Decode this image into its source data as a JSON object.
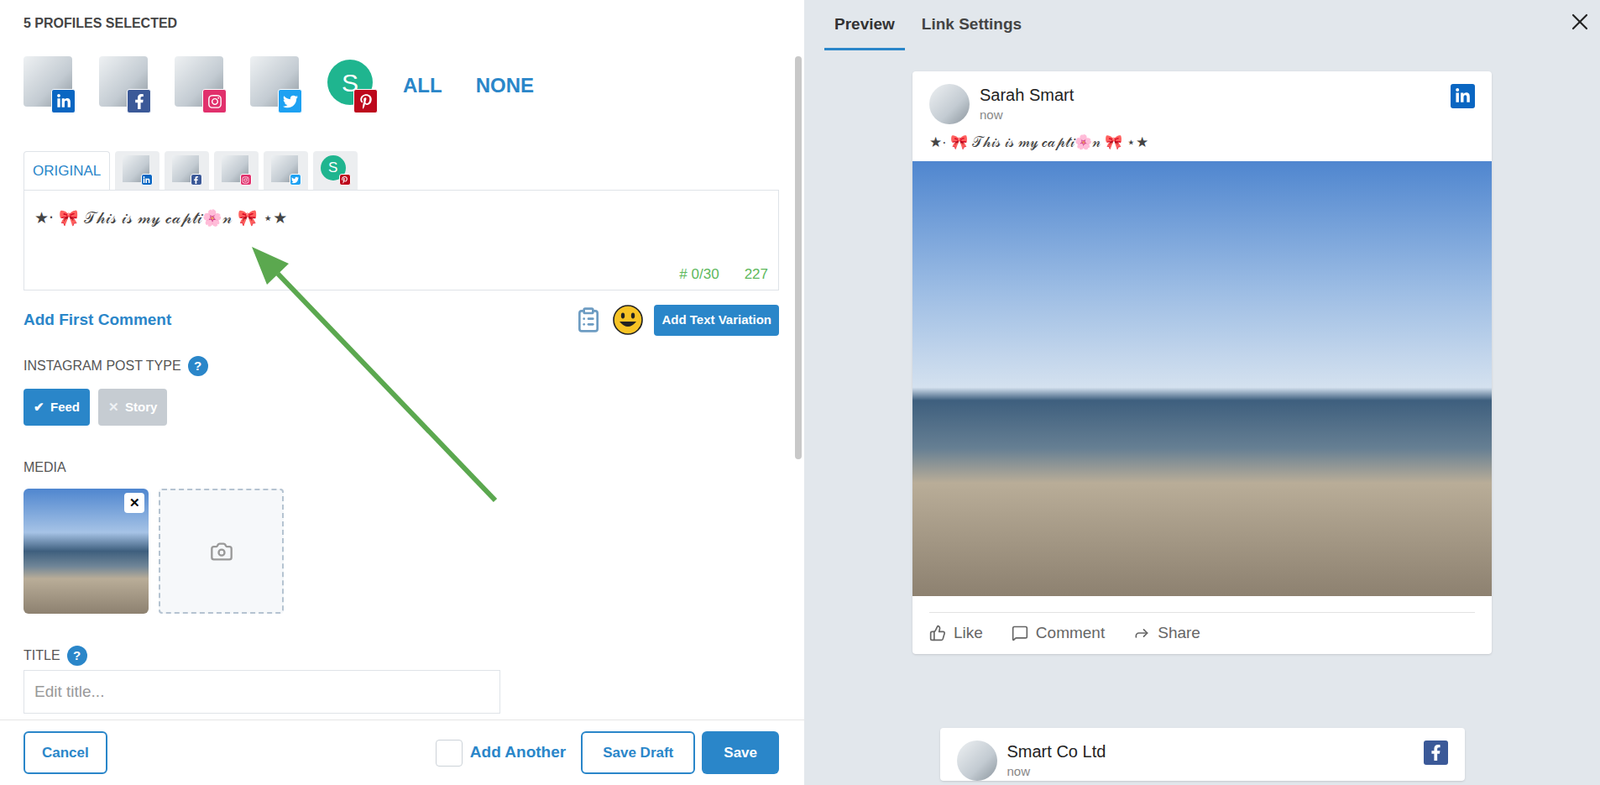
{
  "header": {
    "profiles_selected": "5 PROFILES SELECTED",
    "all": "ALL",
    "none": "NONE"
  },
  "profiles": [
    {
      "kind": "linkedin"
    },
    {
      "kind": "facebook"
    },
    {
      "kind": "instagram"
    },
    {
      "kind": "twitter"
    },
    {
      "kind": "pinterest",
      "letter": "S"
    }
  ],
  "editor_tabs": [
    {
      "kind": "text",
      "label": "ORIGINAL",
      "selected": true
    },
    {
      "kind": "linkedin",
      "selected": false
    },
    {
      "kind": "facebook",
      "selected": false
    },
    {
      "kind": "instagram",
      "selected": false
    },
    {
      "kind": "twitter",
      "selected": false
    },
    {
      "kind": "pinterest",
      "letter": "S",
      "selected": false
    }
  ],
  "caption": {
    "text": "★· 🎀 𝒯𝒽𝒾𝓈 𝒾𝓈 𝓂𝓎 𝒸𝒶𝓅𝓉𝒾🌸𝓃 🎀 ⋆★",
    "hashtags": "# 0/30",
    "remaining": "227"
  },
  "add_first_comment": "Add First Comment",
  "add_text_variation": "Add Text Variation",
  "post_type": {
    "label": "INSTAGRAM POST TYPE",
    "help": "?",
    "options": [
      {
        "label": "Feed",
        "mark": "✔",
        "selected": true
      },
      {
        "label": "Story",
        "mark": "✕",
        "selected": false
      }
    ]
  },
  "media": {
    "label": "MEDIA",
    "remove": "✕"
  },
  "title": {
    "label": "TITLE",
    "help": "?",
    "placeholder": "Edit title..."
  },
  "footer": {
    "cancel": "Cancel",
    "add_another": {
      "label": "Add Another",
      "checked": false
    },
    "save_draft": "Save Draft",
    "save": "Save"
  },
  "preview": {
    "tabs": [
      {
        "label": "Preview",
        "selected": true
      },
      {
        "label": "Link Settings",
        "selected": false
      }
    ],
    "cards": [
      {
        "name": "Sarah Smart",
        "time": "now",
        "kind": "linkedin",
        "caption": "★· 🎀 𝒯𝒽𝒾𝓈 𝒾𝓈 𝓂𝓎 𝒸𝒶𝓅𝓉𝒾🌸𝓃 🎀 ⋆★",
        "actions": [
          "Like",
          "Comment",
          "Share"
        ]
      },
      {
        "name": "Smart Co Ltd",
        "time": "now",
        "kind": "facebook"
      }
    ]
  }
}
